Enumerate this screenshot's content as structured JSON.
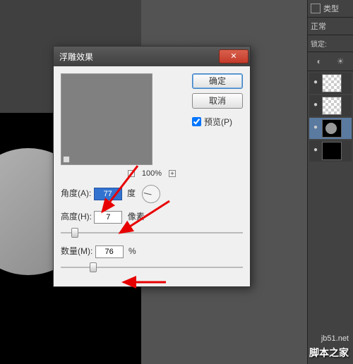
{
  "topBar": {
    "kindLabel": "类型",
    "blendMode": "正常",
    "lockLabel": "锁定:"
  },
  "layers": [
    {
      "visible": true,
      "thumb": "checker"
    },
    {
      "visible": true,
      "thumb": "checker"
    },
    {
      "visible": true,
      "thumb": "circ",
      "selected": true
    },
    {
      "visible": true,
      "thumb": "black"
    }
  ],
  "dialog": {
    "title": "浮雕效果",
    "okLabel": "确定",
    "cancelLabel": "取消",
    "previewLabel": "预览(P)",
    "previewChecked": true,
    "zoom": "100%",
    "angle": {
      "label": "角度(A):",
      "value": "77",
      "unit": "度"
    },
    "height": {
      "label": "高度(H):",
      "value": "7",
      "unit": "像素",
      "sliderPos": 6
    },
    "amount": {
      "label": "数量(M):",
      "value": "76",
      "unit": "%",
      "sliderPos": 16
    }
  },
  "watermark": {
    "url": "jb51.net",
    "text": "脚本之家"
  }
}
